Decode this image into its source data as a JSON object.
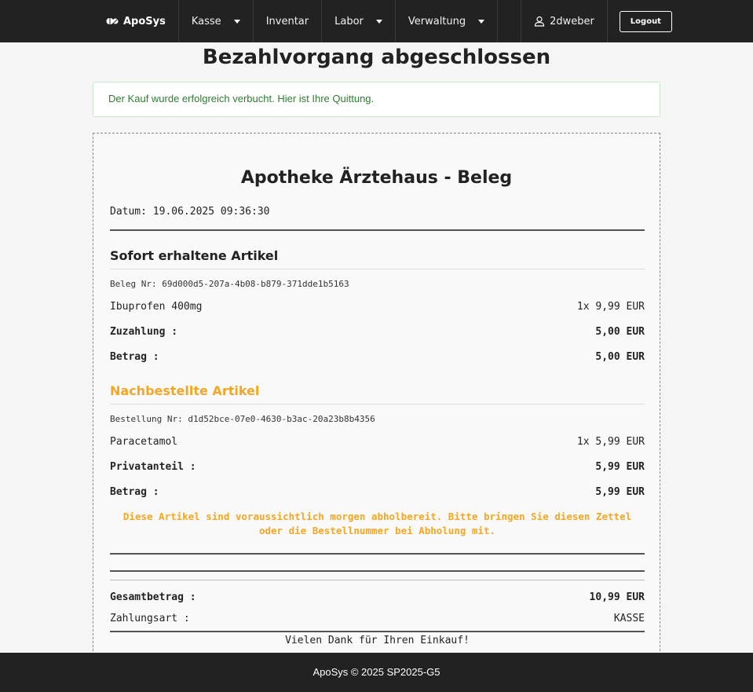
{
  "navbar": {
    "brand": "ApoSys",
    "items": [
      {
        "label": "Kasse",
        "dropdown": true
      },
      {
        "label": "Inventar",
        "dropdown": false
      },
      {
        "label": "Labor",
        "dropdown": true
      },
      {
        "label": "Verwaltung",
        "dropdown": true
      }
    ],
    "user": "2dweber",
    "logout": "Logout"
  },
  "page_title": "Bezahlvorgang abgeschlossen",
  "alert": "Der Kauf wurde erfolgreich verbucht. Hier ist Ihre Quittung.",
  "receipt": {
    "title": "Apotheke Ärztehaus - Beleg",
    "date": "Datum: 19.06.2025 09:36:30",
    "immediate": {
      "title": "Sofort erhaltene Artikel",
      "number": "Beleg Nr: 69d000d5-207a-4b08-b879-371dde1b5163",
      "item_name": "Ibuprofen 400mg",
      "item_qty_price": "1x 9,99 EUR",
      "copay_label": "Zuzahlung :",
      "copay_value": "5,00 EUR",
      "amount_label": "Betrag :",
      "amount_value": "5,00 EUR"
    },
    "ordered": {
      "title": "Nachbestellte Artikel",
      "number": "Bestellung Nr: d1d52bce-07e0-4630-b3ac-20a23b8b4356",
      "item_name": "Paracetamol",
      "item_qty_price": "1x 5,99 EUR",
      "private_label": "Privatanteil :",
      "private_value": "5,99 EUR",
      "amount_label": "Betrag :",
      "amount_value": "5,99 EUR",
      "notice": "Diese Artikel sind voraussichtlich morgen abholbereit. Bitte bringen Sie diesen Zettel oder die Bestellnummer bei Abholung mit."
    },
    "total_label": "Gesamtbetrag :",
    "total_value": "10,99 EUR",
    "payment_label": "Zahlungsart :",
    "payment_value": "KASSE",
    "thanks": "Vielen Dank für Ihren Einkauf!"
  },
  "footer": "ApoSys © 2025 SP2025-G5",
  "colors": {
    "navbar_bg": "#222222",
    "accent_orange": "#f5a623",
    "success_text": "#2e7d32"
  },
  "icons": {
    "brand": "pills-icon",
    "user": "user-icon",
    "dropdown": "caret-down-icon"
  }
}
